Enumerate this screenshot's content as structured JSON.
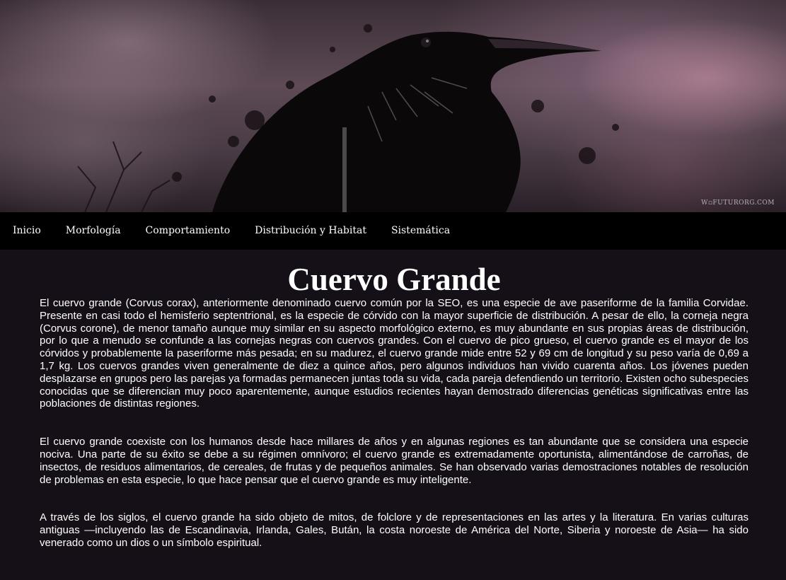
{
  "hero": {
    "watermark": "W▫FUTURORG.COM"
  },
  "nav": {
    "items": [
      {
        "label": "Inicio"
      },
      {
        "label": "Morfología"
      },
      {
        "label": "Comportamiento"
      },
      {
        "label": "Distribución y Habitat"
      },
      {
        "label": "Sistemática"
      }
    ]
  },
  "main": {
    "title": "Cuervo Grande",
    "paragraphs": [
      "El cuervo grande (Corvus corax), anteriormente denominado cuervo común por la SEO, es una especie de ave paseriforme de la familia Corvidae. Presente en casi todo el hemisferio septentrional, es la especie de córvido con la mayor superficie de distribución. A pesar de ello, la corneja negra (Corvus corone), de menor tamaño aunque muy similar en su aspecto morfológico externo, es muy abundante en sus propias áreas de distribución, por lo que a menudo se confunde a las cornejas negras con cuervos grandes. Con el cuervo de pico grueso, el cuervo grande es el mayor de los córvidos y probablemente la paseriforme más pesada; en su madurez, el cuervo grande mide entre 52 y 69 cm de longitud y su peso varía de 0,69 a 1,7 kg. Los cuervos grandes viven generalmente de diez a quince años, pero algunos individuos han vivido cuarenta años. Los jóvenes pueden desplazarse en grupos pero las parejas ya formadas permanecen juntas toda su vida, cada pareja defendiendo un territorio. Existen ocho subespecies conocidas que se diferencian muy poco aparentemente, aunque estudios recientes hayan demostrado diferencias genéticas significativas entre las poblaciones de distintas regiones.",
      "El cuervo grande coexiste con los humanos desde hace millares de años y en algunas regiones es tan abundante que se considera una especie nociva. Una parte de su éxito se debe a su régimen omnívoro; el cuervo grande es extremadamente oportunista, alimentándose de carroñas, de insectos, de residuos alimentarios, de cereales, de frutas y de pequeños animales. Se han observado varias demostraciones notables de resolución de problemas en esta especie, lo que hace pensar que el cuervo grande es muy inteligente.",
      "A través de los siglos, el cuervo grande ha sido objeto de mitos, de folclore y de representaciones en las artes y la literatura. En varias culturas antiguas —incluyendo las de Escandinavia, Irlanda, Gales, Bután, la costa noroeste de América del Norte, Siberia y noroeste de Asia— ha sido venerado como un dios o un símbolo espiritual."
    ]
  }
}
